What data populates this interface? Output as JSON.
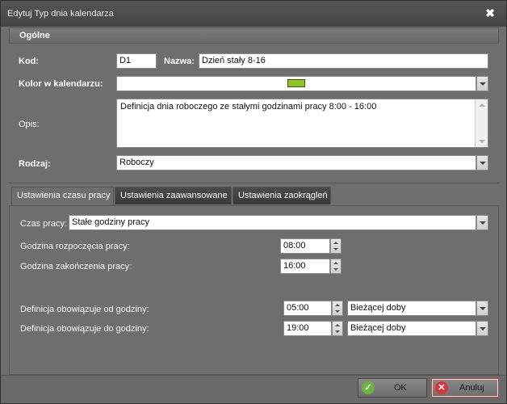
{
  "window": {
    "title": "Edytuj Typ dnia kalendarza",
    "close_glyph": "✖"
  },
  "general": {
    "section_title": "Ogólne",
    "code_label": "Kod:",
    "code_value": "D1",
    "name_label": "Nazwa:",
    "name_value": "Dzień stały 8-16",
    "color_label": "Kolor w kalendarzu:",
    "color_value": "#8fc31f",
    "description_label": "Opis:",
    "description_value": "Definicja dnia roboczego ze stałymi godzinami pracy 8:00 - 16:00",
    "kind_label": "Rodzaj:",
    "kind_value": "Roboczy"
  },
  "tabs": [
    {
      "label": "Ustawienia czasu pracy",
      "active": true
    },
    {
      "label": "Ustawienia zaawansowane",
      "active": false
    },
    {
      "label": "Ustawienia zaokrągleń",
      "active": false
    }
  ],
  "work_time": {
    "mode_label": "Czas pracy:",
    "mode_value": "Stałe godziny pracy",
    "start_label": "Godzina rozpoczęcia pracy:",
    "start_value": "08:00",
    "end_label": "Godzina zakończenia pracy:",
    "end_value": "16:00",
    "valid_from_label": "Definicja obowiązuje od godziny:",
    "valid_from_value": "05:00",
    "valid_from_day": "Bieżącej doby",
    "valid_to_label": "Definicja obowiązuje do godziny:",
    "valid_to_value": "19:00",
    "valid_to_day": "Bieżącej doby"
  },
  "footer": {
    "ok_label": "OK",
    "ok_icon": "check-icon",
    "ok_icon_color": "#6cb33f",
    "cancel_label": "Anuluj",
    "cancel_icon": "cancel-icon",
    "cancel_icon_color": "#d9363e"
  }
}
